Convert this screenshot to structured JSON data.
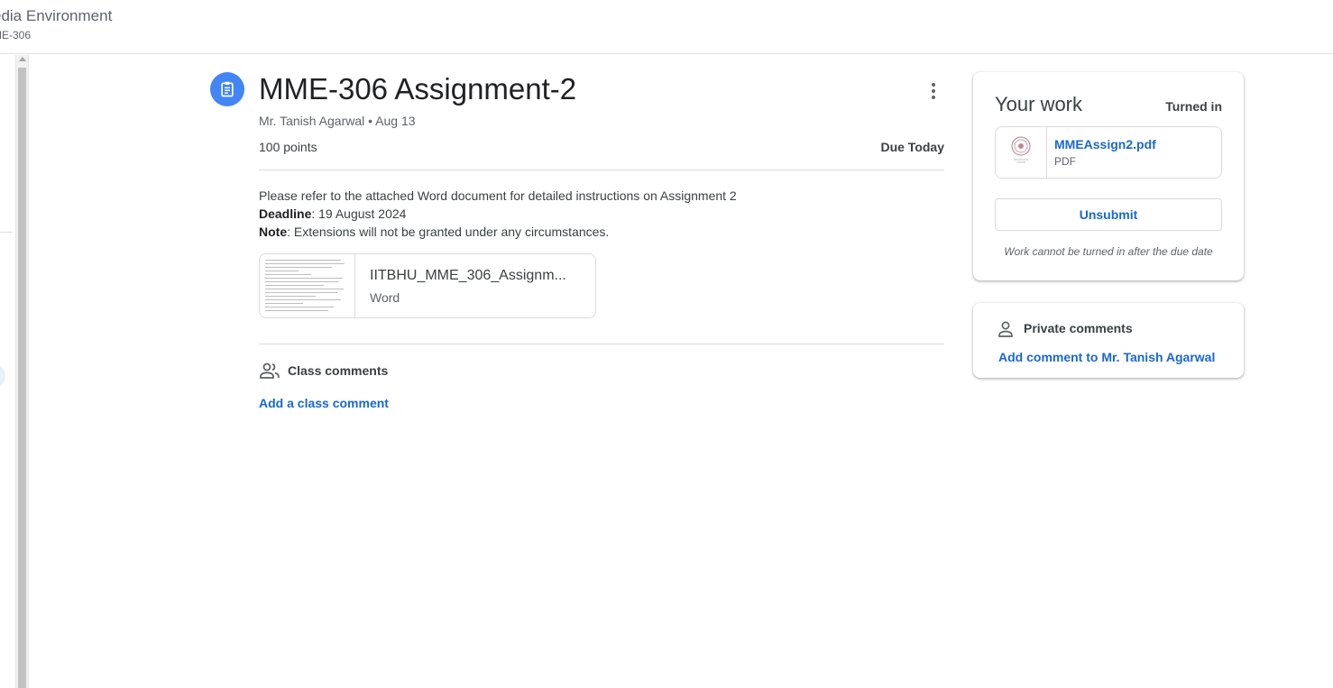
{
  "header": {
    "course_title": "edia Environment",
    "course_code": "ME-306"
  },
  "assignment": {
    "icon": "assignment-clipboard-icon",
    "title": "MME-306 Assignment-2",
    "author_date": "Mr. Tanish Agarwal • Aug 13",
    "points": "100 points",
    "due": "Due Today",
    "instructions": {
      "line1": "Please refer to the attached Word document for detailed instructions on Assignment 2",
      "deadline_label": "Deadline",
      "deadline_value": ": 19 August 2024",
      "note_label": "Note",
      "note_value": ": Extensions will not be granted under any circumstances."
    },
    "attachment": {
      "name": "IITBHU_MME_306_Assignm...",
      "type": "Word"
    }
  },
  "class_comments": {
    "icon": "people-icon",
    "label": "Class comments",
    "add_label": "Add a class comment"
  },
  "your_work": {
    "title": "Your work",
    "status": "Turned in",
    "file": {
      "name": "MMEAssign2.pdf",
      "type": "PDF"
    },
    "unsubmit_label": "Unsubmit",
    "note": "Work cannot be turned in after the due date"
  },
  "private_comments": {
    "icon": "person-icon",
    "label": "Private comments",
    "add_label": "Add comment to Mr. Tanish Agarwal"
  },
  "colors": {
    "accent_blue": "#4285f4",
    "link_blue": "#1967d2",
    "text": "#3c4043",
    "border": "#dadce0"
  }
}
